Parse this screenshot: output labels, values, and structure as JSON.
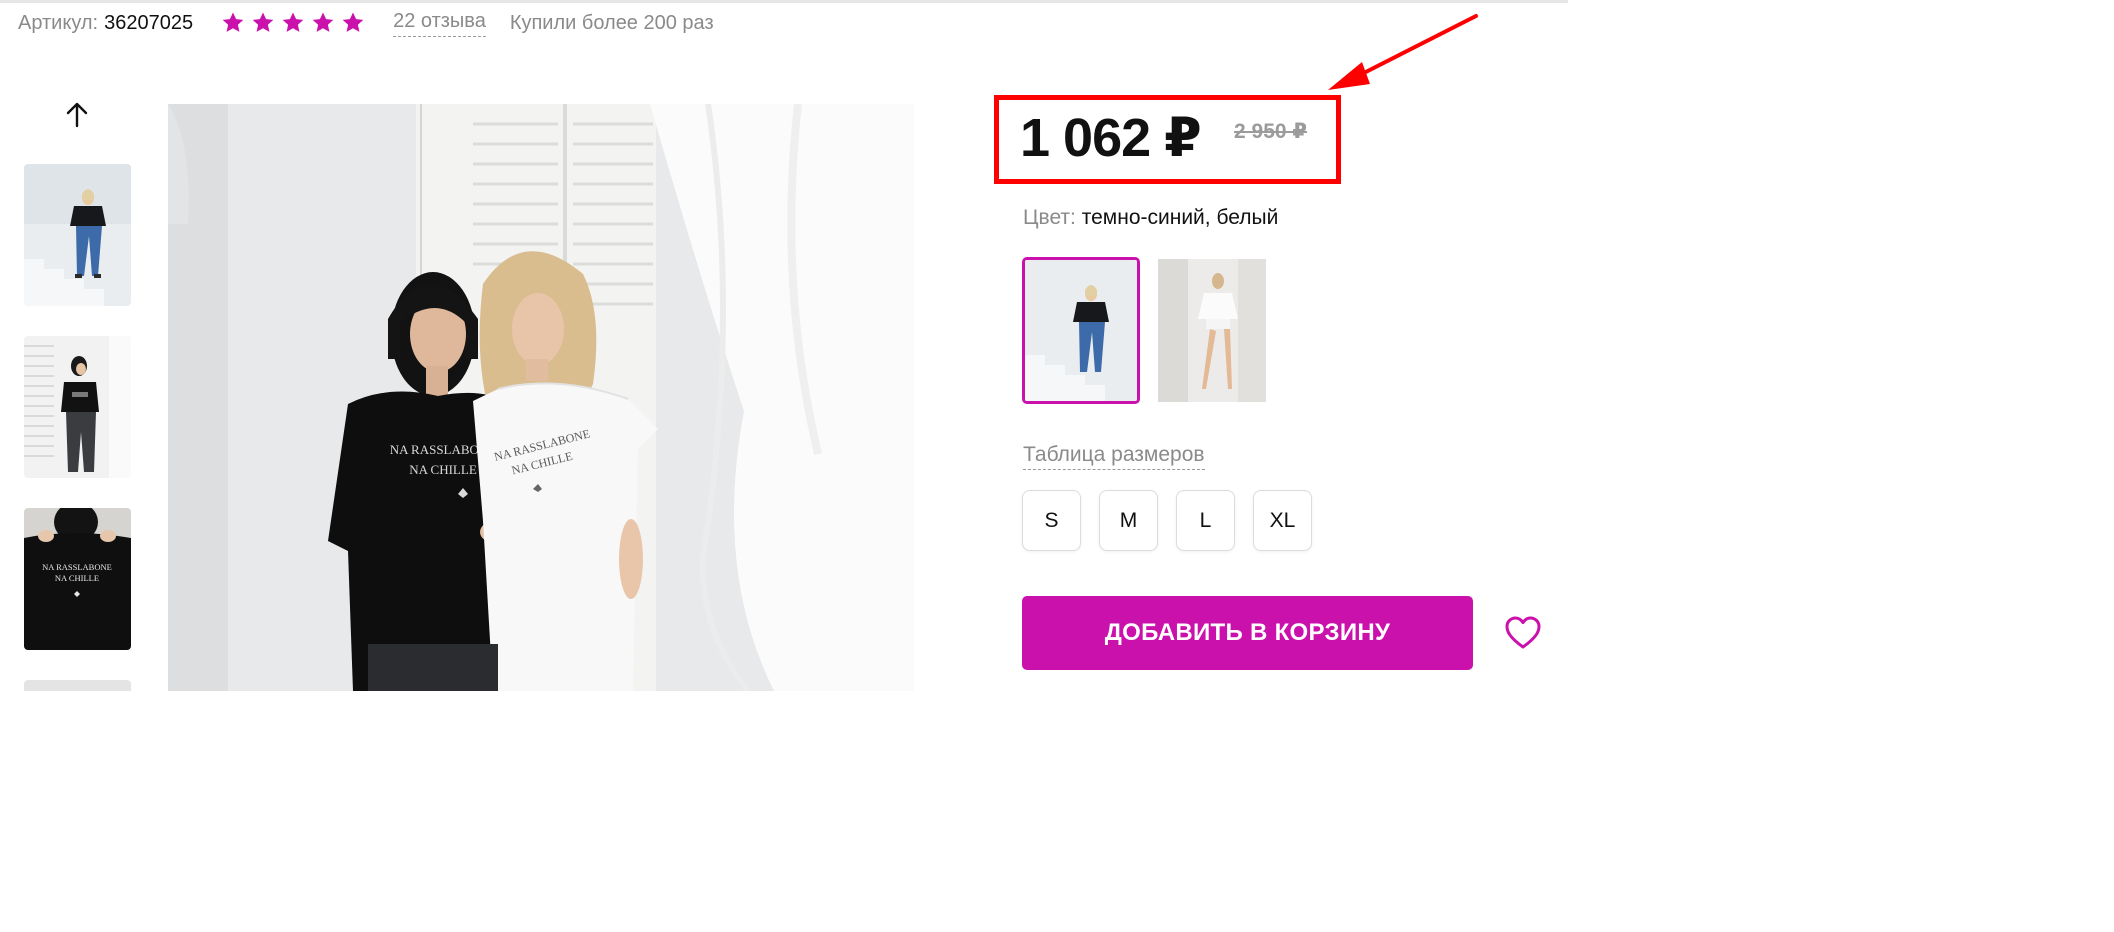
{
  "product": {
    "sku_label": "Артикул:",
    "sku_value": "36207025",
    "rating_stars": 5,
    "reviews_text": "22 отзыва",
    "bought_text": "Купили более 200 раз"
  },
  "price": {
    "current": "1 062 ₽",
    "old": "2 950 ₽"
  },
  "color": {
    "label": "Цвет:",
    "value": "темно-синий, белый"
  },
  "size_table_label": "Таблица размеров",
  "sizes": [
    "S",
    "M",
    "L",
    "XL"
  ],
  "cart_button_label": "ДОБАВИТЬ В КОРЗИНУ",
  "photo": {
    "shirt_print": [
      "NA RASSLABONE",
      "NA CHILLE"
    ]
  },
  "colors": {
    "accent": "#cb11ab",
    "annotation": "#ff0000",
    "muted_text": "#8a8a8a"
  },
  "icons": {
    "thumb_scroll": "arrow-up-icon",
    "rating": "star-icon",
    "favorite": "heart-icon"
  }
}
